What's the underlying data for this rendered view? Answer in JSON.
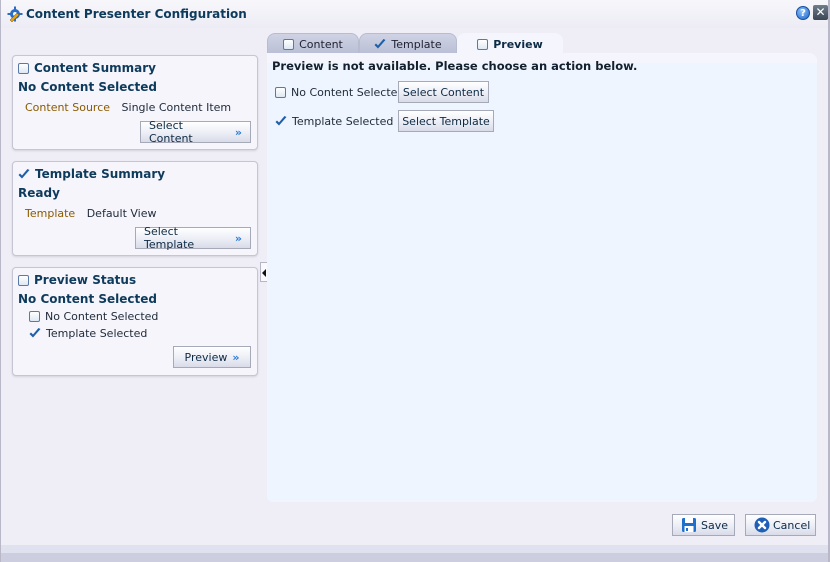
{
  "window": {
    "title": "Content Presenter Configuration",
    "icons": {
      "app": "gear-pencil-icon",
      "help": "help-icon",
      "close": "close-icon"
    },
    "help_glyph": "?",
    "close_glyph": "✕"
  },
  "sidebar": {
    "content_summary": {
      "title": "Content Summary",
      "checked": false,
      "status": "No Content Selected",
      "key": "Content Source",
      "value": "Single Content Item",
      "button": "Select Content"
    },
    "template_summary": {
      "title": "Template Summary",
      "checked": true,
      "status": "Ready",
      "key": "Template",
      "value": "Default View",
      "button": "Select Template"
    },
    "preview_status": {
      "title": "Preview Status",
      "checked": false,
      "status": "No Content Selected",
      "items": [
        {
          "label": "No Content Selected",
          "checked": false
        },
        {
          "label": "Template Selected",
          "checked": true
        }
      ],
      "button": "Preview"
    }
  },
  "tabs": [
    {
      "label": "Content",
      "checked": false,
      "active": false
    },
    {
      "label": "Template",
      "checked": true,
      "active": false
    },
    {
      "label": "Preview",
      "checked": false,
      "active": true
    }
  ],
  "main": {
    "message": "Preview is not available. Please choose an action below.",
    "rows": [
      {
        "label": "No Content Selected",
        "checked": false,
        "button": "Select Content"
      },
      {
        "label": "Template Selected",
        "checked": true,
        "button": "Select Template"
      }
    ]
  },
  "footer": {
    "save": "Save",
    "cancel": "Cancel"
  },
  "colors": {
    "title_text": "#0e3a5c",
    "key_text": "#8a5a00",
    "accent_blue": "#2d7bd8",
    "content_bg": "#eef5fe"
  }
}
